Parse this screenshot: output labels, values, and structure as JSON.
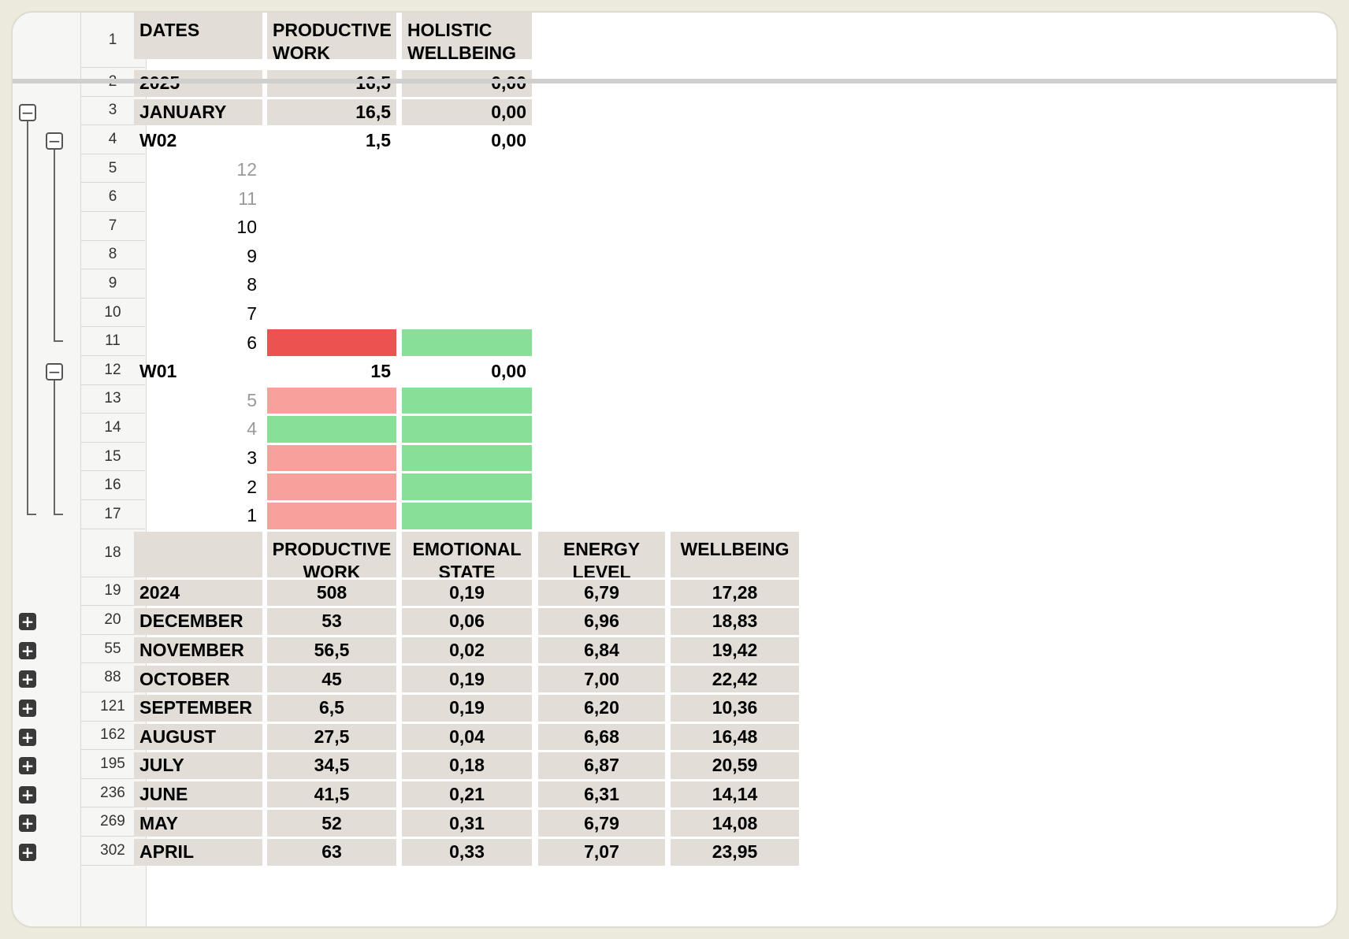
{
  "header": {
    "row_number": "1",
    "dates": "DATES",
    "productive_work": "PRODUCTIVE WORK",
    "holistic_wellbeing": "HOLISTIC WELLBEING"
  },
  "year_2025": {
    "row_number": "2",
    "label": "2025",
    "productive_work": "16,5",
    "holistic_wellbeing": "0,00"
  },
  "january": {
    "row_number": "3",
    "label": "JANUARY",
    "productive_work": "16,5",
    "holistic_wellbeing": "0,00"
  },
  "w02": {
    "row_number": "4",
    "label": "W02",
    "productive_work": "1,5",
    "holistic_wellbeing": "0,00",
    "days": [
      {
        "row": "5",
        "day": "12",
        "muted": true,
        "work": "",
        "wellbeing": ""
      },
      {
        "row": "6",
        "day": "11",
        "muted": true,
        "work": "",
        "wellbeing": ""
      },
      {
        "row": "7",
        "day": "10",
        "muted": false,
        "work": "",
        "wellbeing": ""
      },
      {
        "row": "8",
        "day": "9",
        "muted": false,
        "work": "",
        "wellbeing": ""
      },
      {
        "row": "9",
        "day": "8",
        "muted": false,
        "work": "",
        "wellbeing": ""
      },
      {
        "row": "10",
        "day": "7",
        "muted": false,
        "work": "",
        "wellbeing": ""
      },
      {
        "row": "11",
        "day": "6",
        "muted": false,
        "work": "red",
        "wellbeing": "green"
      }
    ]
  },
  "w01": {
    "row_number": "12",
    "label": "W01",
    "productive_work": "15",
    "holistic_wellbeing": "0,00",
    "days": [
      {
        "row": "13",
        "day": "5",
        "muted": true,
        "work": "pink",
        "wellbeing": "green"
      },
      {
        "row": "14",
        "day": "4",
        "muted": true,
        "work": "green",
        "wellbeing": "green"
      },
      {
        "row": "15",
        "day": "3",
        "muted": false,
        "work": "pink",
        "wellbeing": "green"
      },
      {
        "row": "16",
        "day": "2",
        "muted": false,
        "work": "pink",
        "wellbeing": "green"
      },
      {
        "row": "17",
        "day": "1",
        "muted": false,
        "work": "pink",
        "wellbeing": "green"
      }
    ]
  },
  "header_2024": {
    "row_number": "18",
    "productive_work": "PRODUCTIVE WORK",
    "emotional_state": "EMOTIONAL STATE",
    "energy_level": "ENERGY LEVEL",
    "wellbeing": "WELLBEING"
  },
  "year_2024": {
    "row_number": "19",
    "label": "2024",
    "productive_work": "508",
    "emotional_state": "0,19",
    "energy_level": "6,79",
    "wellbeing": "17,28"
  },
  "months_2024": [
    {
      "row": "20",
      "label": "DECEMBER",
      "work": "53",
      "emotional": "0,06",
      "energy": "6,96",
      "wellbeing": "18,83"
    },
    {
      "row": "55",
      "label": "NOVEMBER",
      "work": "56,5",
      "emotional": "0,02",
      "energy": "6,84",
      "wellbeing": "19,42"
    },
    {
      "row": "88",
      "label": "OCTOBER",
      "work": "45",
      "emotional": "0,19",
      "energy": "7,00",
      "wellbeing": "22,42"
    },
    {
      "row": "121",
      "label": "SEPTEMBER",
      "work": "6,5",
      "emotional": "0,19",
      "energy": "6,20",
      "wellbeing": "10,36"
    },
    {
      "row": "162",
      "label": "AUGUST",
      "work": "27,5",
      "emotional": "0,04",
      "energy": "6,68",
      "wellbeing": "16,48"
    },
    {
      "row": "195",
      "label": "JULY",
      "work": "34,5",
      "emotional": "0,18",
      "energy": "6,87",
      "wellbeing": "20,59"
    },
    {
      "row": "236",
      "label": "JUNE",
      "work": "41,5",
      "emotional": "0,21",
      "energy": "6,31",
      "wellbeing": "14,14"
    },
    {
      "row": "269",
      "label": "MAY",
      "work": "52",
      "emotional": "0,31",
      "energy": "6,79",
      "wellbeing": "14,08"
    },
    {
      "row": "302",
      "label": "APRIL",
      "work": "63",
      "emotional": "0,33",
      "energy": "7,07",
      "wellbeing": "23,95"
    }
  ],
  "colors": {
    "header_bg": "#e2ddd6",
    "red": "#eb5350",
    "pink": "#f8a19c",
    "green": "#88df98"
  },
  "icons": {
    "collapse": "minus-square-icon",
    "expand": "plus-square-icon"
  }
}
